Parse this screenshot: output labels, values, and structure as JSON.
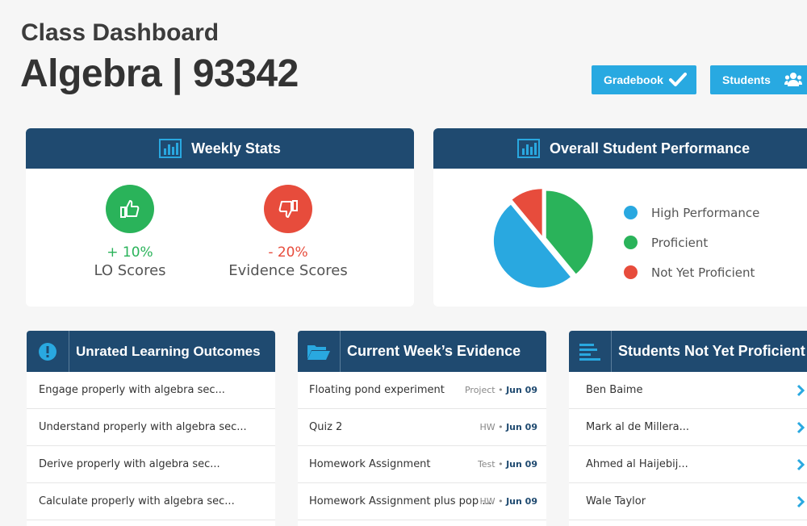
{
  "header": {
    "subtitle": "Class Dashboard",
    "title": "Algebra | 93342",
    "gradebook_label": "Gradebook",
    "students_label": "Students"
  },
  "weekly_stats": {
    "title": "Weekly Stats",
    "lo": {
      "change": "+ 10%",
      "label": "LO Scores",
      "color": "#2ab35a"
    },
    "evidence": {
      "change": "- 20%",
      "label": "Evidence Scores",
      "color": "#e74c3c"
    }
  },
  "overall": {
    "title": "Overall Student Performance",
    "legend": [
      {
        "label": "High Performance",
        "color": "#29a8e0"
      },
      {
        "label": "Proficient",
        "color": "#2ab35a"
      },
      {
        "label": "Not Yet Proficient",
        "color": "#e74c3c"
      }
    ]
  },
  "chart_data": {
    "type": "pie",
    "categories": [
      "High Performance",
      "Proficient",
      "Not Yet Proficient"
    ],
    "values": [
      50,
      39,
      11
    ],
    "colors": [
      "#29a8e0",
      "#2ab35a",
      "#e74c3c"
    ]
  },
  "unrated": {
    "title": "Unrated Learning Outcomes",
    "items": [
      "Engage properly with algebra sec...",
      "Understand properly with algebra sec...",
      "Derive properly with algebra sec...",
      "Calculate properly with algebra sec..."
    ]
  },
  "evidence": {
    "title": "Current Week’s Evidence",
    "items": [
      {
        "name": "Floating pond experiment",
        "type": "Project",
        "date": "Jun 09"
      },
      {
        "name": "Quiz 2",
        "type": "HW",
        "date": "Jun 09"
      },
      {
        "name": "Homework Assignment",
        "type": "Test",
        "date": "Jun 09"
      },
      {
        "name": "Homework Assignment plus pop ...",
        "type": "HW",
        "date": "Jun 09"
      }
    ]
  },
  "not_proficient": {
    "title": "Students Not Yet Proficient",
    "items": [
      "Ben Baime",
      "Mark al de Millera...",
      "Ahmed al Haijebij...",
      "Wale Taylor"
    ]
  }
}
